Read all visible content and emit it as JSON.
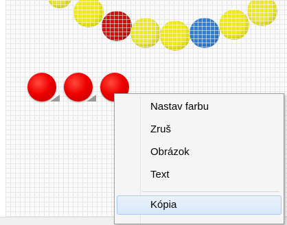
{
  "canvas": {
    "bead_colors": {
      "yellow": "#ece91f",
      "red": "#d80e0e",
      "blue": "#2f7fd6"
    }
  },
  "context_menu": {
    "items": [
      {
        "label": "Nastav farbu"
      },
      {
        "label": "Zruš"
      },
      {
        "label": "Obrázok"
      },
      {
        "label": "Text"
      },
      {
        "label": "Kópia"
      }
    ],
    "hover_index": 4
  }
}
